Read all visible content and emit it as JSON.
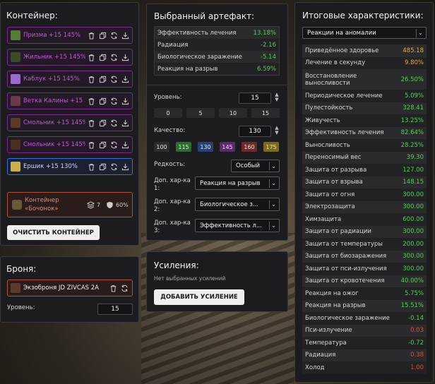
{
  "container": {
    "title": "Контейнер:",
    "items": [
      {
        "name": "Призма +15 145%",
        "style": "purple",
        "thumb": "#5a7a3a"
      },
      {
        "name": "Жильник +15 145%",
        "style": "purple",
        "thumb": "#3a4a2a"
      },
      {
        "name": "Каблук +15 145%",
        "style": "purple",
        "thumb": "#9a6ad0"
      },
      {
        "name": "Ветка Калины +15 145%",
        "style": "purple",
        "thumb": "#6a3a4a"
      },
      {
        "name": "Смольник +15 145%",
        "style": "purple",
        "thumb": "#5a3a2a"
      },
      {
        "name": "Смольник +15 145%",
        "style": "purple",
        "thumb": "#4a3020"
      },
      {
        "name": "Ершик +15 130%",
        "style": "blue",
        "thumb": "#c8b050"
      }
    ],
    "box": {
      "name": "Контейнер «Бочонок»",
      "slots": "7",
      "protection": "60%",
      "color": "#e08a70"
    },
    "clear_label": "ОЧИСТИТЬ КОНТЕЙНЕР"
  },
  "armor": {
    "title": "Броня:",
    "item": "Экзоброня JD ZIVCAS 2A",
    "level_label": "Уровень:",
    "level": "15"
  },
  "artifact": {
    "title": "Выбранный артефакт:",
    "stats": [
      {
        "label": "Эффективность лечения",
        "value": "13.18%",
        "color": "#4fd24f"
      },
      {
        "label": "Радиация",
        "value": "-2.16",
        "color": "#4fd24f"
      },
      {
        "label": "Биологическое заражение",
        "value": "-5.14",
        "color": "#4fd24f"
      },
      {
        "label": "Реакция на разрыв",
        "value": "6.59%",
        "color": "#4fd24f"
      }
    ],
    "level_label": "Уровень:",
    "level": "15",
    "level_presets": [
      "0",
      "5",
      "10",
      "15"
    ],
    "quality_label": "Качество:",
    "quality": "130",
    "quality_presets": [
      {
        "label": "100",
        "bg": "#2c2c2e",
        "fg": "#e8e8e8"
      },
      {
        "label": "115",
        "bg": "#2e6b2e",
        "fg": "#e8e8e8"
      },
      {
        "label": "130",
        "bg": "#27407a",
        "fg": "#e8e8e8"
      },
      {
        "label": "145",
        "bg": "#5a2a6e",
        "fg": "#e8e8e8"
      },
      {
        "label": "160",
        "bg": "#6e2a2a",
        "fg": "#e8e8e8"
      },
      {
        "label": "175",
        "bg": "#7a6a1a",
        "fg": "#e8e8e8"
      }
    ],
    "rarity_label": "Редкость:",
    "rarity": "Особый",
    "extra": [
      {
        "label1": "Доп. хар-ка",
        "label2": "1:",
        "value": "Реакция на разрыв"
      },
      {
        "label1": "Доп. хар-ка",
        "label2": "2:",
        "value": "Биологическое з..."
      },
      {
        "label1": "Доп. хар-ка",
        "label2": "3:",
        "value": "Эффективность л..."
      }
    ]
  },
  "boosts": {
    "title": "Усиления:",
    "empty": "Нет выбранных усилений",
    "add_label": "ДОБАВИТЬ УСИЛЕНИЕ"
  },
  "final": {
    "title": "Итоговые характеристики:",
    "filter": "Реакции на аномалии",
    "stats": [
      {
        "label": "Приведённое здоровье",
        "value": "485.18",
        "color": "#e8a93a"
      },
      {
        "label": "Лечение в секунду",
        "value": "9.80%",
        "color": "#e8a93a"
      },
      {
        "label": "Восстановление выносливости",
        "value": "26.50%",
        "color": "#4fd24f"
      },
      {
        "label": "Периодическое лечение",
        "value": "5.09%",
        "color": "#4fd24f"
      },
      {
        "label": "Пулестойкость",
        "value": "328.41",
        "color": "#4fd24f"
      },
      {
        "label": "Живучесть",
        "value": "13.25%",
        "color": "#4fd24f"
      },
      {
        "label": "Эффективность лечения",
        "value": "82.64%",
        "color": "#4fd24f"
      },
      {
        "label": "Выносливость",
        "value": "28.25%",
        "color": "#4fd24f"
      },
      {
        "label": "Переносимый вес",
        "value": "39.30",
        "color": "#4fd24f"
      },
      {
        "label": "Защита от разрыва",
        "value": "127.00",
        "color": "#4fd24f"
      },
      {
        "label": "Защита от взрыва",
        "value": "148.15",
        "color": "#4fd24f"
      },
      {
        "label": "Защита от огня",
        "value": "300.00",
        "color": "#4fd24f"
      },
      {
        "label": "Электрозащита",
        "value": "300.00",
        "color": "#4fd24f"
      },
      {
        "label": "Химзащита",
        "value": "600.00",
        "color": "#4fd24f"
      },
      {
        "label": "Защита от радиации",
        "value": "300.00",
        "color": "#4fd24f"
      },
      {
        "label": "Защита от температуры",
        "value": "200.00",
        "color": "#4fd24f"
      },
      {
        "label": "Защита от биозаражения",
        "value": "300.00",
        "color": "#4fd24f"
      },
      {
        "label": "Защита от пси-излучения",
        "value": "300.00",
        "color": "#4fd24f"
      },
      {
        "label": "Защита от кровотечения",
        "value": "40.00%",
        "color": "#4fd24f"
      },
      {
        "label": "Реакция на ожог",
        "value": "5.75%",
        "color": "#4fd24f"
      },
      {
        "label": "Реакция на разрыв",
        "value": "15.51%",
        "color": "#4fd24f"
      },
      {
        "label": "Биологическое заражение",
        "value": "-0.14",
        "color": "#4fd24f"
      },
      {
        "label": "Пси-излучение",
        "value": "0.03",
        "color": "#e04a3a"
      },
      {
        "label": "Температура",
        "value": "-0.72",
        "color": "#4fd24f"
      },
      {
        "label": "Радиация",
        "value": "0.38",
        "color": "#e04a3a"
      },
      {
        "label": "Холод",
        "value": "1.00",
        "color": "#e04a3a"
      }
    ]
  }
}
